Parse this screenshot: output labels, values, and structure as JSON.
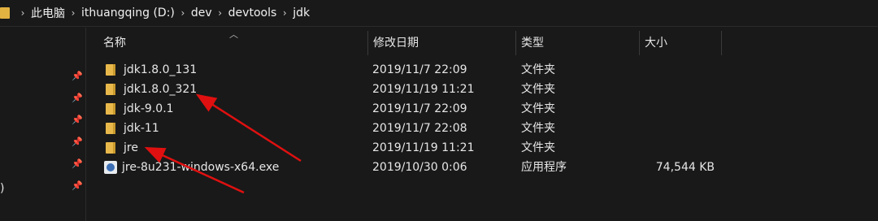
{
  "address": {
    "crumbs": [
      "此电脑",
      "ithuangqing (D:)",
      "dev",
      "devtools",
      "jdk"
    ]
  },
  "nav": {
    "paren_text": ")"
  },
  "columns": {
    "name": "名称",
    "date": "修改日期",
    "type": "类型",
    "size": "大小"
  },
  "files": [
    {
      "name": "jdk1.8.0_131",
      "date": "2019/11/7 22:09",
      "type": "文件夹",
      "size": "",
      "icon": "folder-icon"
    },
    {
      "name": "jdk1.8.0_321",
      "date": "2019/11/19 11:21",
      "type": "文件夹",
      "size": "",
      "icon": "folder-icon"
    },
    {
      "name": "jdk-9.0.1",
      "date": "2019/11/7 22:09",
      "type": "文件夹",
      "size": "",
      "icon": "folder-icon"
    },
    {
      "name": "jdk-11",
      "date": "2019/11/7 22:08",
      "type": "文件夹",
      "size": "",
      "icon": "folder-icon"
    },
    {
      "name": "jre",
      "date": "2019/11/19 11:21",
      "type": "文件夹",
      "size": "",
      "icon": "folder-icon"
    },
    {
      "name": "jre-8u231-windows-x64.exe",
      "date": "2019/10/30 0:06",
      "type": "应用程序",
      "size": "74,544 KB",
      "icon": "exe-icon"
    }
  ],
  "colors": {
    "background": "#191919",
    "folder": "#e8b84a",
    "annotation_arrow": "#e01010"
  }
}
